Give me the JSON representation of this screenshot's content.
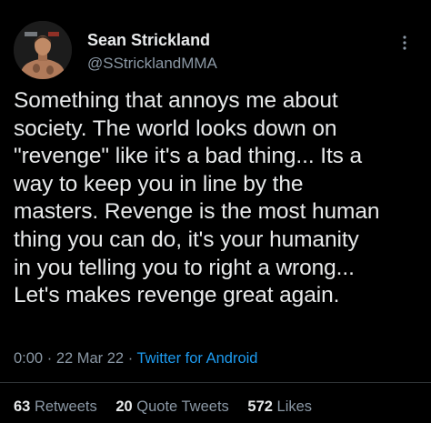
{
  "author": {
    "display_name": "Sean Strickland",
    "handle": "@SStricklandMMA",
    "avatar": "avatar-photo-shirtless-man",
    "more_icon": "more-vertical-icon"
  },
  "tweet": {
    "lines": [
      "Something that annoys me about",
      "society. The world looks down on",
      "\"revenge\" like it's a bad thing... Its a",
      "way to keep you in line by the",
      "masters. Revenge is the most human",
      "thing you can do, it's your humanity",
      "in you telling you to right a wrong...",
      "Let's makes revenge great again."
    ]
  },
  "meta": {
    "time": "0:00",
    "separator": "·",
    "date": "22 Mar 22",
    "source": "Twitter for Android"
  },
  "stats": {
    "retweets": {
      "count": "63",
      "label": "Retweets"
    },
    "quote_tweets": {
      "count": "20",
      "label": "Quote Tweets"
    },
    "likes": {
      "count": "572",
      "label": "Likes"
    }
  },
  "colors": {
    "background": "#000000",
    "text": "#e7e9ea",
    "secondary": "#8b98a5",
    "link": "#1d9bf0"
  }
}
